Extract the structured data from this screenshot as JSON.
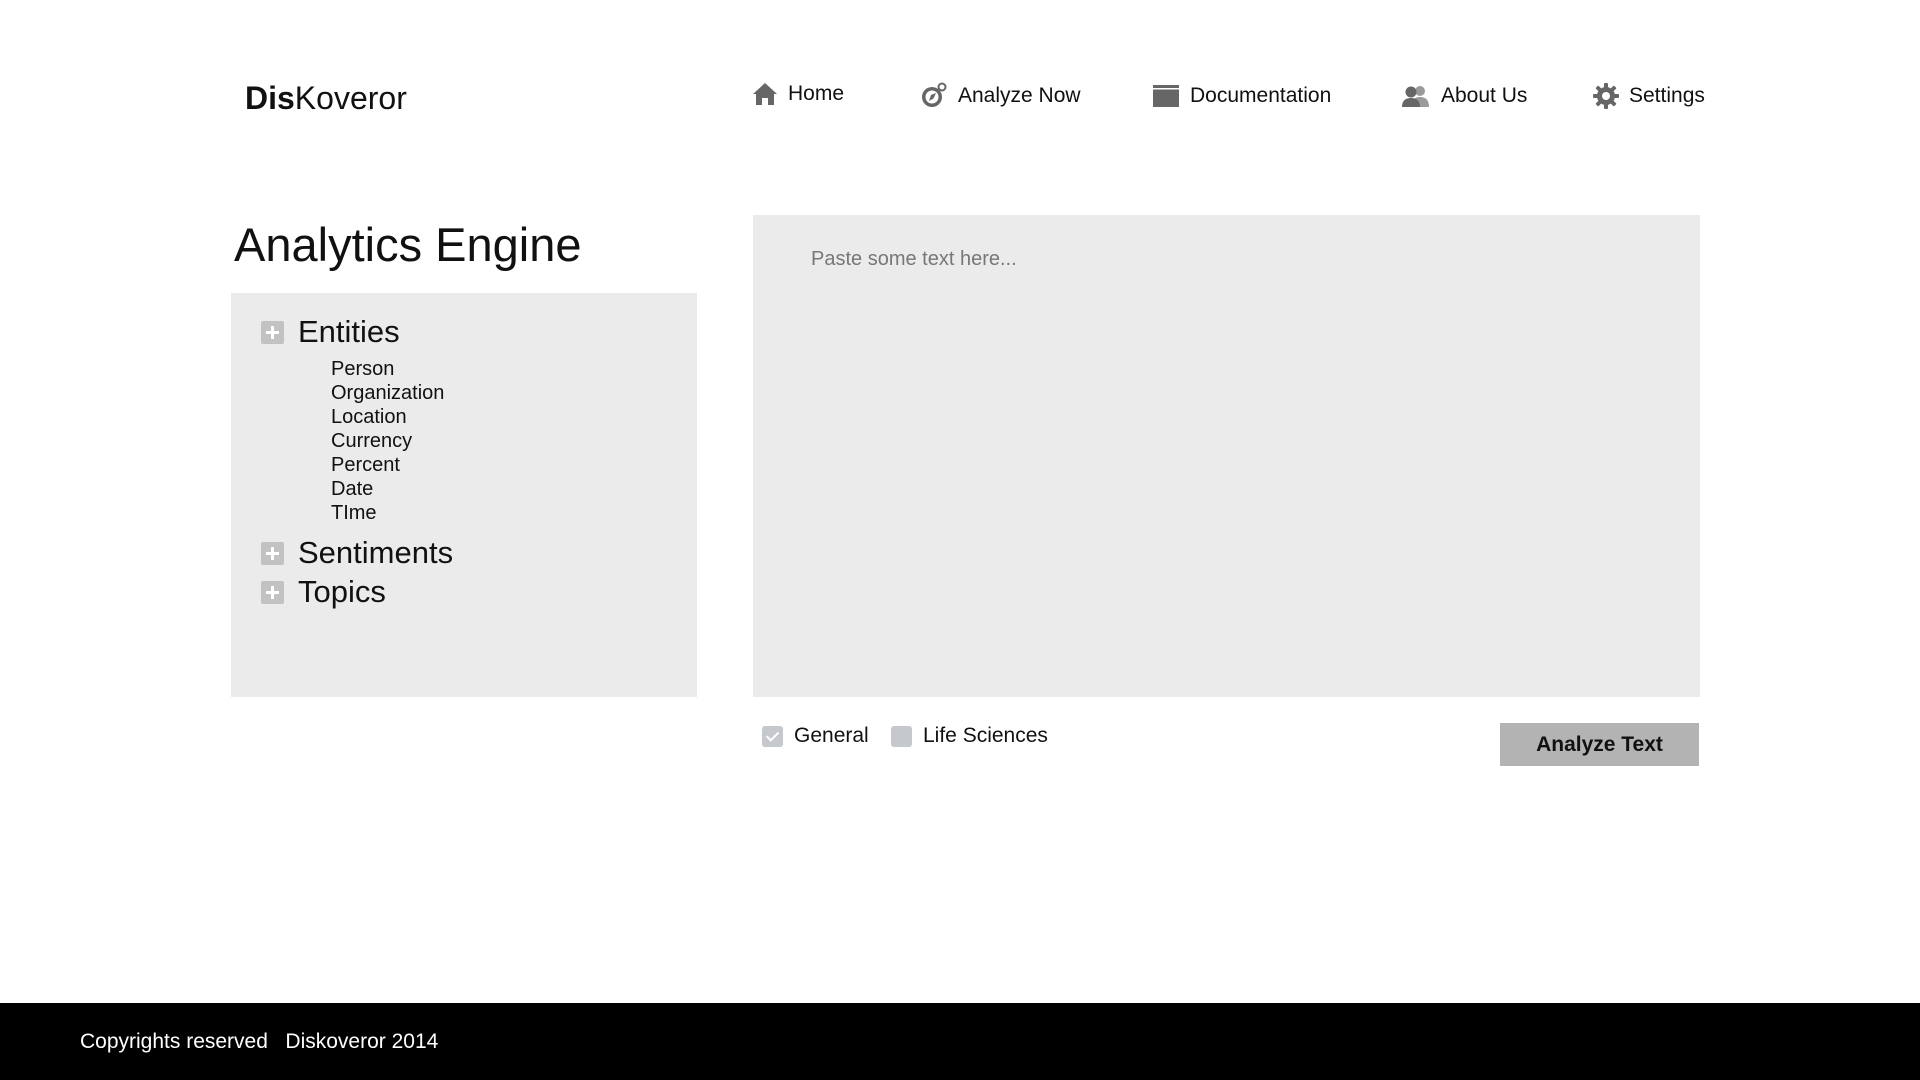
{
  "header": {
    "logo_bold": "Dis",
    "logo_regular": "Koveror",
    "nav": [
      {
        "label": "Home",
        "icon": "home-icon"
      },
      {
        "label": "Analyze Now",
        "icon": "compass-icon"
      },
      {
        "label": "Documentation",
        "icon": "folder-icon"
      },
      {
        "label": "About Us",
        "icon": "users-icon"
      },
      {
        "label": "Settings",
        "icon": "gear-icon"
      }
    ]
  },
  "sidebar": {
    "title": "Analytics Engine",
    "tree": [
      {
        "label": "Entities",
        "children": [
          "Person",
          "Organization",
          "Location",
          "Currency",
          "Percent",
          "Date",
          "TIme"
        ]
      },
      {
        "label": "Sentiments"
      },
      {
        "label": "Topics"
      }
    ]
  },
  "editor": {
    "placeholder": "Paste some text here...",
    "value": ""
  },
  "options": {
    "domains": [
      {
        "label": "General",
        "checked": true
      },
      {
        "label": "Life Sciences",
        "checked": false
      }
    ],
    "analyze_button": "Analyze Text"
  },
  "footer": {
    "text": "Copyrights reserved   Diskoveror 2014"
  },
  "colors": {
    "panel_bg": "#ebebeb",
    "button_bg": "#b3b3b3",
    "footer_bg": "#000000",
    "icon_gray": "#666666"
  }
}
